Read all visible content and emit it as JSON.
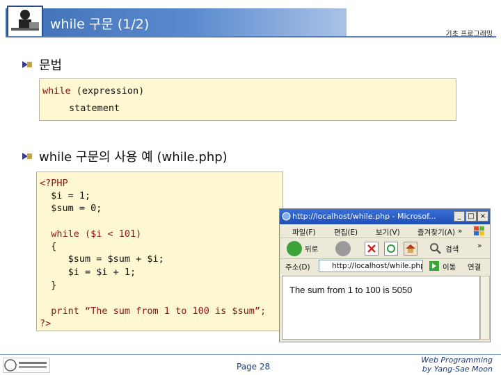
{
  "header": {
    "title": "while 구문 (1/2)",
    "course": "기초 프로그래밍"
  },
  "bullets": {
    "syntax_label": "문법",
    "example_label": "while 구문의 사용 예 (while.php)"
  },
  "syntax_code": {
    "line1_keyword": "while",
    "line1_rest": " (expression)",
    "line2": "statement"
  },
  "example_code": {
    "lines": [
      "<?PHP",
      "  $i = 1;",
      "  $sum = 0;",
      "  while ($i < 101)",
      "  {",
      "     $sum = $sum + $i;",
      "     $i = $i + 1;",
      "  }",
      "  print “The sum from 1 to 100 is $sum”;",
      "?>"
    ]
  },
  "browser": {
    "title": "http://localhost/while.php - Microsof...",
    "menu": [
      "파일(F)",
      "편집(E)",
      "보기(V)",
      "즐겨찾기(A)",
      "»"
    ],
    "back_label": "뒤로",
    "search_label": "검색",
    "address_label": "주소(D)",
    "address_value": "http://localhost/while.php",
    "go_label": "이동",
    "links_label": "연결",
    "content": "The sum from 1 to 100 is 5050"
  },
  "footer": {
    "page": "Page 28",
    "credit_line1": "Web Programming",
    "credit_line2": "by Yang-Sae Moon"
  },
  "colors": {
    "title_blue": "#3f6fb4",
    "code_bg": "#fdf7d2",
    "keyword": "#8b1414",
    "footer_text": "#1c3d7a"
  }
}
